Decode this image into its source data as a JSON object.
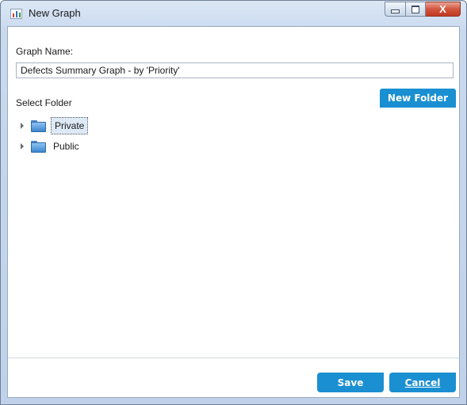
{
  "window": {
    "title": "New Graph",
    "icon": "bar-chart-icon",
    "controls": {
      "minimize": "minimize-icon",
      "maximize": "maximize-icon",
      "close_glyph": "X"
    }
  },
  "form": {
    "graph_name_label": "Graph Name:",
    "graph_name_value": "Defects Summary Graph - by 'Priority'",
    "select_folder_label": "Select Folder",
    "new_folder_button": "New Folder"
  },
  "tree": {
    "items": [
      {
        "label": "Private",
        "icon": "folder-icon",
        "selected": true
      },
      {
        "label": "Public",
        "icon": "folder-icon",
        "selected": false
      }
    ]
  },
  "footer": {
    "save_button": "Save",
    "cancel_button": "Cancel"
  },
  "colors": {
    "accent": "#1a8fd1",
    "close_button": "#c13a22"
  }
}
